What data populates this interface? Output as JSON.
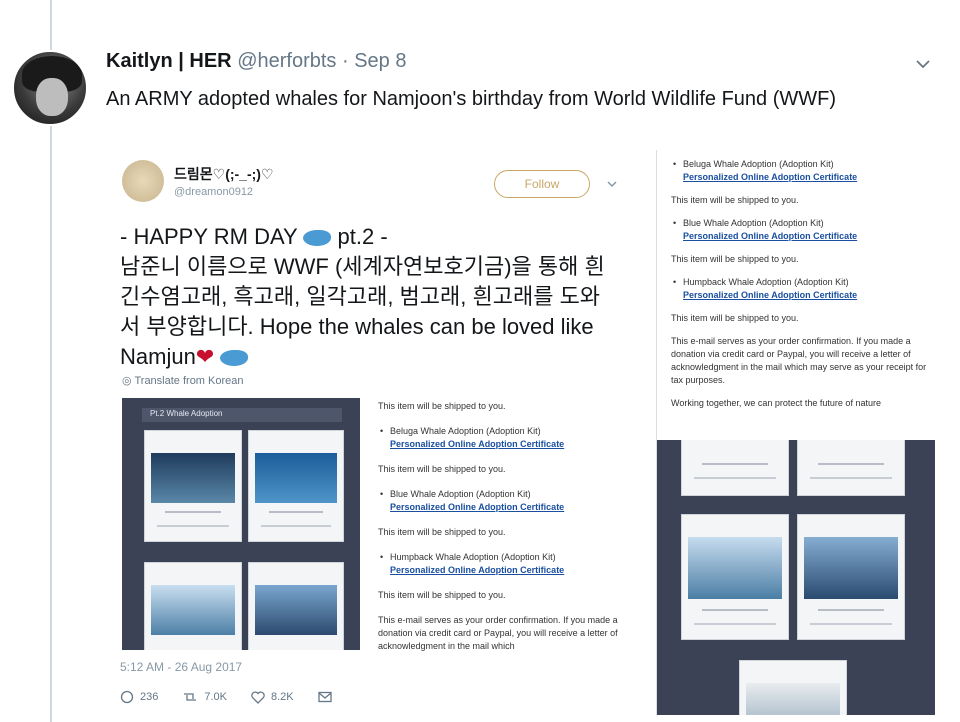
{
  "tweet": {
    "name": "Kaitlyn | HER",
    "handle": "@herforbts",
    "separator": "·",
    "date": "Sep 8",
    "text": "An ARMY adopted whales for Namjoon's birthday from World Wildlife Fund (WWF)"
  },
  "embedded": {
    "name": "드림몬♡(;-_-;)♡",
    "handle": "@dreamon0912",
    "follow_label": "Follow",
    "body_line1": "- HAPPY RM DAY",
    "body_line1_suffix": "pt.2 -",
    "body_line2": "남준니 이름으로 WWF (세계자연보호기금)을 통해 흰긴수염고래, 흑고래, 일각고래, 범고래, 흰고래를 도와서 부양합니다. Hope the whales can be loved like Namjun",
    "translate": "Translate from Korean",
    "grid_title": "Pt.2 Whale Adoption",
    "timestamp": "5:12 AM - 26 Aug 2017",
    "replies": "236",
    "retweets": "7.0K",
    "likes": "8.2K",
    "doc": {
      "shipped": "This item will be shipped to you.",
      "item1": "Beluga Whale Adoption (Adoption Kit)",
      "item2": "Blue Whale Adoption (Adoption Kit)",
      "item3": "Humpback Whale Adoption (Adoption Kit)",
      "cert_link": "Personalized Online Adoption Certificate",
      "confirmation": "This e-mail serves as your order confirmation. If you made a donation via credit card or Paypal, you will receive a letter of acknowledgment in the mail which"
    }
  },
  "right_doc": {
    "item0": "Beluga Whale Adoption (Adoption Kit)",
    "item2": "Blue Whale Adoption (Adoption Kit)",
    "item3": "Humpback Whale Adoption (Adoption Kit)",
    "cert_link": "Personalized Online Adoption Certificate",
    "shipped": "This item will be shipped to you.",
    "confirmation": "This e-mail serves as your order confirmation. If you made a donation via credit card or Paypal, you will receive a letter of acknowledgment in the mail which may serve as your receipt for tax purposes.",
    "together": "Working together, we can protect the future of nature"
  },
  "colors": {
    "link_blue": "#1a4fa0",
    "follow_gold": "#c9a764",
    "heart_red": "#c8102e",
    "thread_gray": "#cfd9de"
  }
}
